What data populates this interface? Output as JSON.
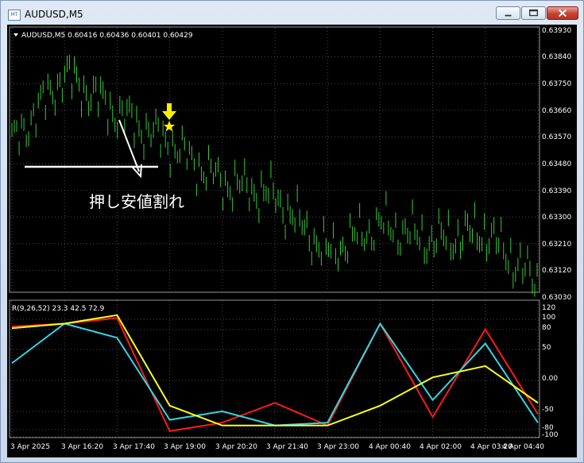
{
  "window": {
    "title": "AUDUSD,M5",
    "icon_text": "MT"
  },
  "chart": {
    "symbol_info": "AUDUSD,M5  0.60416 0.60436 0.60401 0.60429",
    "price_labels": [
      "0.63930",
      "0.63840",
      "0.63750",
      "0.63660",
      "0.63570",
      "0.63480",
      "0.63390",
      "0.63300",
      "0.63210",
      "0.63120",
      "0.63030"
    ],
    "annotation": "押し安値割れ",
    "colors": {
      "bars": "#33cc33",
      "line_red": "#ff1a1a",
      "line_cyan": "#33d6e6",
      "line_yellow": "#ffff1a",
      "marker": "#ffee00",
      "annotation": "#ffffff"
    }
  },
  "indicator": {
    "info": "R(9,26,52) 23.3 42.5 72.9",
    "levels": [
      "120",
      "100",
      "80",
      "50",
      "0.00",
      "-50",
      "-80",
      "-100"
    ]
  },
  "time_labels": [
    "3 Apr 2025",
    "3 Apr 16:20",
    "3 Apr 17:40",
    "3 Apr 19:00",
    "3 Apr 20:20",
    "3 Apr 21:40",
    "3 Apr 23:00",
    "4 Apr 00:40",
    "4 Apr 02:00",
    "4 Apr 03:20",
    "4 Apr 04:40"
  ],
  "chart_data": {
    "type": "line",
    "title": "AUDUSD,M5",
    "ylim": [
      0.6303,
      0.6393
    ],
    "x": [
      "3 Apr 2025",
      "3 Apr 16:20",
      "3 Apr 17:40",
      "3 Apr 19:00",
      "3 Apr 20:20",
      "3 Apr 21:40",
      "3 Apr 23:00",
      "4 Apr 00:40",
      "4 Apr 02:00",
      "4 Apr 03:20",
      "4 Apr 04:40"
    ],
    "series": [
      {
        "values": [
          0.6355,
          0.6378,
          0.6365,
          0.6355,
          0.6342,
          0.6337,
          0.6318,
          0.6328,
          0.6322,
          0.6325,
          0.6308
        ]
      }
    ],
    "indicator": {
      "name": "R(9,26,52)",
      "ylim": [
        -120,
        120
      ],
      "series": [
        {
          "values": [
            75,
            80,
            90,
            -110,
            -95,
            -60,
            -100,
            80,
            -85,
            70,
            -80
          ]
        },
        {
          "values": [
            10,
            80,
            55,
            -90,
            -75,
            -100,
            -95,
            80,
            -55,
            45,
            -95
          ]
        },
        {
          "values": [
            72,
            80,
            95,
            -65,
            -100,
            -100,
            -100,
            -65,
            -15,
            5,
            -60
          ]
        }
      ]
    }
  }
}
